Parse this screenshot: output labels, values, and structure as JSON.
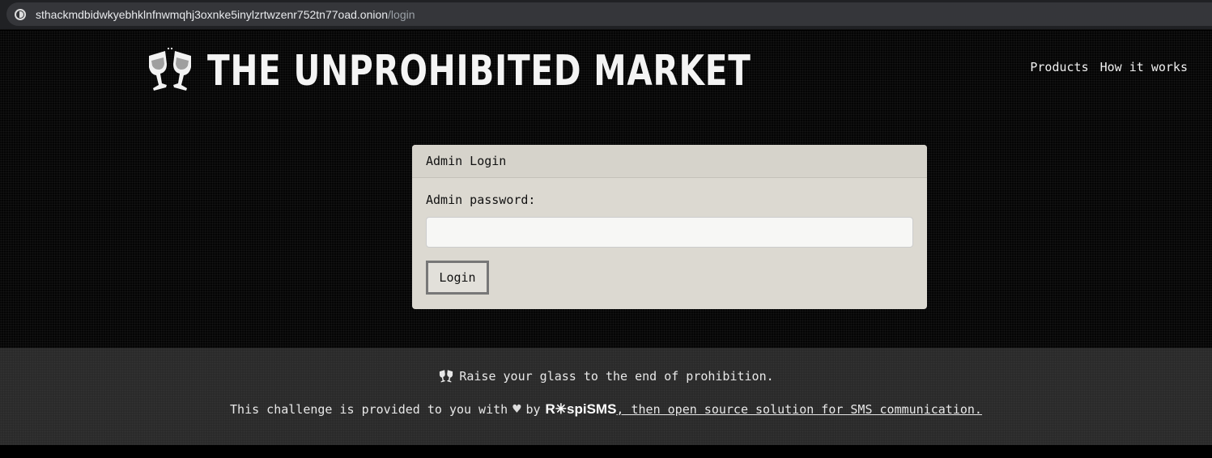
{
  "browser": {
    "url_host": "sthackmdbidwkyebhklnfnwmqhj3oxnke5inylzrtwzenr752tn77oad.onion",
    "url_path": "/login"
  },
  "header": {
    "title": "THE UNPROHIBITED MARKET",
    "logo_icon": "toast-glasses-icon",
    "nav": [
      "Products",
      "How it works"
    ]
  },
  "login_card": {
    "title": "Admin Login",
    "password_label": "Admin password:",
    "password_value": "",
    "password_placeholder": "",
    "submit_label": "Login"
  },
  "footer": {
    "tagline": "Raise your glass to the end of prohibition.",
    "credit_prefix": "This challenge is provided to you with",
    "credit_by": "by",
    "brand": "R✳spiSMS",
    "credit_link": ", then open source solution for SMS communication."
  }
}
